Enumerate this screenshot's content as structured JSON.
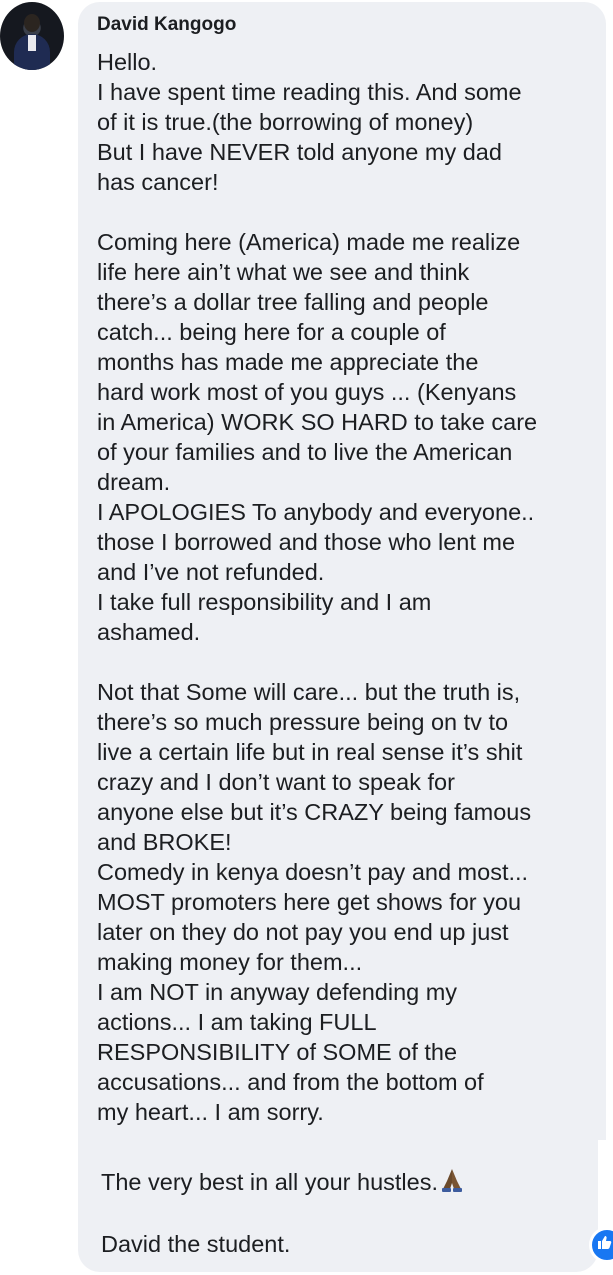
{
  "comment": {
    "author": "David Kangogo",
    "lines": [
      "Hello.",
      "I have spent time reading this. And some",
      "of it is true.(the borrowing of money)",
      "But I have NEVER told anyone my dad",
      "has cancer!",
      "",
      "Coming here (America) made me realize",
      "life here ain’t what we see and think",
      "there’s a dollar tree falling and people",
      "catch... being here for a couple of",
      "months has made me appreciate the",
      "hard work most of you guys ... (Kenyans",
      "in America) WORK SO HARD to take care",
      "of your families and to live the American",
      "dream.",
      "I APOLOGIES To anybody and everyone..",
      "those I borrowed and those who lent me",
      "and I’ve not refunded.",
      "I take full responsibility and I am",
      "ashamed.",
      "",
      "Not that Some will care... but the truth is,",
      "there’s so much pressure being on tv to",
      "live a certain life but in real sense it’s shit",
      "crazy and I don’t want to speak for",
      "anyone else but it’s CRAZY being famous",
      "and BROKE!",
      "Comedy in kenya doesn’t pay and most...",
      "MOST promoters here get shows for you",
      "later on they do not pay you end up just",
      "making money for them...",
      "I am NOT in anyway defending my",
      "actions... I am taking FULL",
      "RESPONSIBILITY of SOME of the",
      "accusations... and from the bottom of",
      "my heart... I am sorry."
    ],
    "closing": "The very best in all your hustles.",
    "closing_emoji": "praying-hands-icon",
    "signature": "David the student."
  },
  "colors": {
    "bubble": "#eef0f4",
    "text": "#1c1e21",
    "reaction": "#1877f2"
  }
}
